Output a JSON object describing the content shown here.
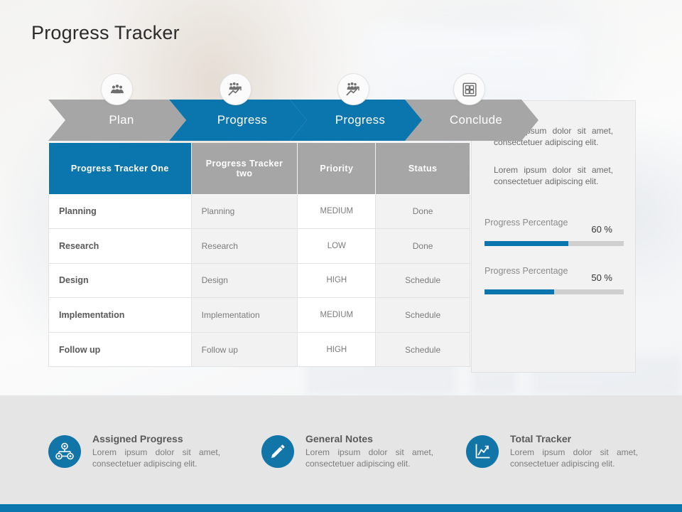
{
  "slide": {
    "title": "Progress Tracker",
    "accent_color": "#0b76ad",
    "gray_color": "#a6a6a6",
    "bottom_band_color": "#e5e5e5"
  },
  "process": {
    "steps": [
      {
        "label": "Plan",
        "state": "gray",
        "icon": "people-group-icon"
      },
      {
        "label": "Progress",
        "state": "blue",
        "icon": "people-growth-chart-icon"
      },
      {
        "label": "Progress",
        "state": "blue",
        "icon": "people-growth-chart-icon"
      },
      {
        "label": "Conclude",
        "state": "gray",
        "icon": "grid-squares-icon"
      }
    ]
  },
  "table": {
    "headers": [
      "Progress Tracker One",
      "Progress Tracker two",
      "Priority",
      "Status"
    ],
    "rows": [
      {
        "name": "Planning",
        "tracker_two": "Planning",
        "priority": "MEDIUM",
        "status": "Done"
      },
      {
        "name": "Research",
        "tracker_two": "Research",
        "priority": "LOW",
        "status": "Done"
      },
      {
        "name": "Design",
        "tracker_two": "Design",
        "priority": "HIGH",
        "status": "Schedule"
      },
      {
        "name": "Implementation",
        "tracker_two": "Implementation",
        "priority": "MEDIUM",
        "status": "Schedule"
      },
      {
        "name": "Follow up",
        "tracker_two": "Follow up",
        "priority": "HIGH",
        "status": "Schedule"
      }
    ]
  },
  "side_panel": {
    "paragraphs": [
      "Lorem ipsum dolor sit amet, consectetuer adipiscing elit.",
      "Lorem ipsum dolor sit amet, consectetuer adipiscing elit."
    ],
    "progress_bars": [
      {
        "label": "Progress Percentage",
        "value": "60 %",
        "percent": 60
      },
      {
        "label": "Progress Percentage",
        "value": "50 %",
        "percent": 50
      }
    ]
  },
  "features": [
    {
      "icon": "org-chart-icon",
      "title": "Assigned Progress",
      "desc": "Lorem ipsum dolor sit amet, consectetuer adipiscing elit."
    },
    {
      "icon": "pencil-icon",
      "title": "General Notes",
      "desc": "Lorem ipsum dolor sit amet, consectetuer adipiscing elit."
    },
    {
      "icon": "line-chart-icon",
      "title": "Total Tracker",
      "desc": "Lorem ipsum dolor sit amet, consectetuer adipiscing elit."
    }
  ]
}
